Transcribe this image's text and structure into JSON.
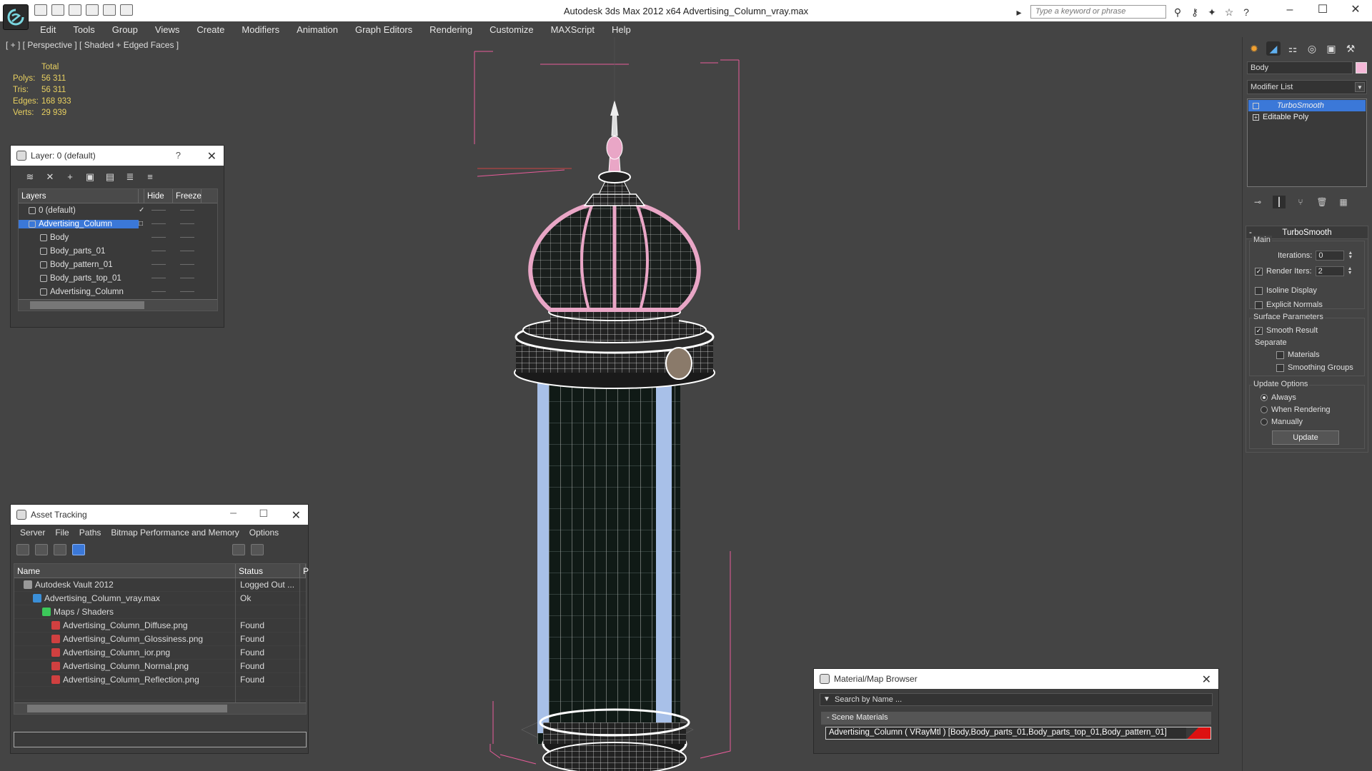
{
  "app": {
    "title": "Autodesk 3ds Max  2012 x64      Advertising_Column_vray.max",
    "search_placeholder": "Type a keyword or phrase"
  },
  "menu": [
    "Edit",
    "Tools",
    "Group",
    "Views",
    "Create",
    "Modifiers",
    "Animation",
    "Graph Editors",
    "Rendering",
    "Customize",
    "MAXScript",
    "Help"
  ],
  "viewport": {
    "label": "[ + ] [ Perspective ] [ Shaded + Edged Faces ]",
    "stats": {
      "header": "Total",
      "rows": [
        {
          "label": "Polys:",
          "value": "56 311"
        },
        {
          "label": "Tris:",
          "value": "56 311"
        },
        {
          "label": "Edges:",
          "value": "168 933"
        },
        {
          "label": "Verts:",
          "value": "29 939"
        }
      ]
    }
  },
  "layer_dialog": {
    "title": "Layer: 0 (default)",
    "help": "?",
    "columns": [
      "Layers",
      "Hide",
      "Freeze"
    ],
    "rows": [
      {
        "name": "0 (default)",
        "level": 0
      },
      {
        "name": "Advertising_Column",
        "level": 0,
        "selected": true
      },
      {
        "name": "Body",
        "level": 1
      },
      {
        "name": "Body_parts_01",
        "level": 1
      },
      {
        "name": "Body_pattern_01",
        "level": 1
      },
      {
        "name": "Body_parts_top_01",
        "level": 1
      },
      {
        "name": "Advertising_Column",
        "level": 1
      }
    ]
  },
  "asset_dialog": {
    "title": "Asset Tracking",
    "menu": [
      "Server",
      "File",
      "Paths",
      "Bitmap Performance and Memory",
      "Options"
    ],
    "columns": [
      "Name",
      "Status",
      "P"
    ],
    "rows": [
      {
        "name": "Autodesk Vault 2012",
        "status": "Logged Out ...",
        "indent": 1,
        "icon": "vault-icon"
      },
      {
        "name": "Advertising_Column_vray.max",
        "status": "Ok",
        "indent": 2,
        "icon": "max-file-icon"
      },
      {
        "name": "Maps / Shaders",
        "status": "",
        "indent": 3,
        "icon": "maps-icon"
      },
      {
        "name": "Advertising_Column_Diffuse.png",
        "status": "Found",
        "indent": 4,
        "icon": "png-icon"
      },
      {
        "name": "Advertising_Column_Glossiness.png",
        "status": "Found",
        "indent": 4,
        "icon": "png-icon"
      },
      {
        "name": "Advertising_Column_ior.png",
        "status": "Found",
        "indent": 4,
        "icon": "png-icon"
      },
      {
        "name": "Advertising_Column_Normal.png",
        "status": "Found",
        "indent": 4,
        "icon": "png-icon"
      },
      {
        "name": "Advertising_Column_Reflection.png",
        "status": "Found",
        "indent": 4,
        "icon": "png-icon"
      }
    ]
  },
  "material_browser": {
    "title": "Material/Map Browser",
    "search_placeholder": "Search by Name ...",
    "section": "- Scene Materials",
    "item": "Advertising_Column ( VRayMtl ) [Body,Body_parts_01,Body_parts_top_01,Body_pattern_01]"
  },
  "command_panel": {
    "object_name": "Body",
    "object_color": "#f5b8d8",
    "modifier_list_label": "Modifier List",
    "stack": [
      {
        "name": "TurboSmooth",
        "selected": true
      },
      {
        "name": "Editable Poly",
        "selected": false
      }
    ],
    "rollout_title": "TurboSmooth",
    "main_group": "Main",
    "iterations_label": "Iterations:",
    "iterations_value": "0",
    "render_iters_label": "Render Iters:",
    "render_iters_value": "2",
    "render_iters_checked": true,
    "isoline_label": "Isoline Display",
    "explicit_normals_label": "Explicit Normals",
    "surface_group": "Surface Parameters",
    "smooth_result_label": "Smooth Result",
    "separate_label": "Separate",
    "materials_label": "Materials",
    "smoothing_groups_label": "Smoothing Groups",
    "update_group": "Update Options",
    "always_label": "Always",
    "when_rendering_label": "When Rendering",
    "manually_label": "Manually",
    "update_button": "Update"
  },
  "colors": {
    "viewport_bg": "#444444",
    "selection_blue": "#3b78d8",
    "wire_pink": "#e85c9a",
    "stats_yellow": "#e8d060"
  }
}
